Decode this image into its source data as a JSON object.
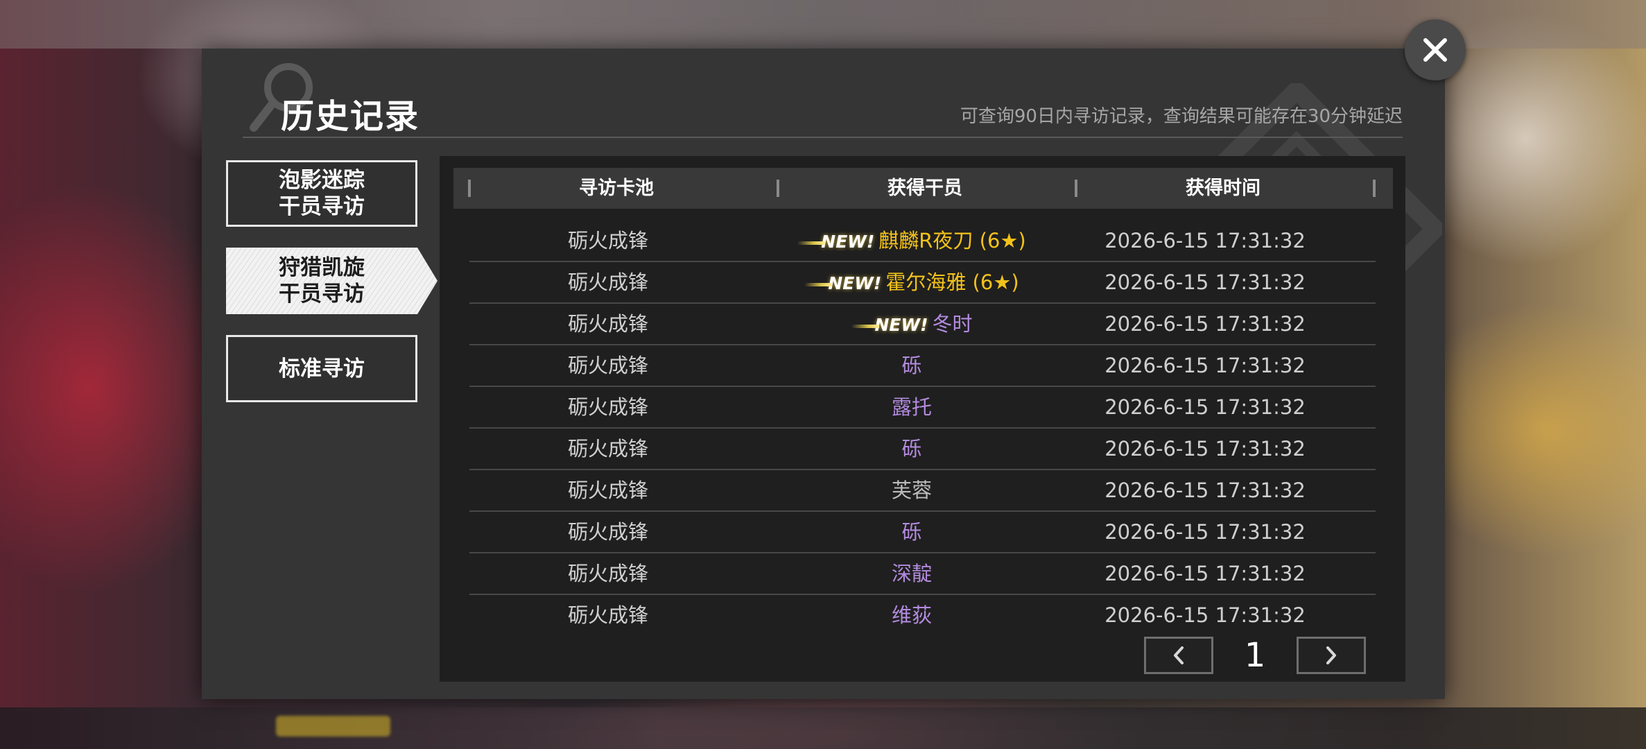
{
  "dialog": {
    "title": "历史记录",
    "subtitle": "可查询90日内寻访记录，查询结果可能存在30分钟延迟"
  },
  "tabs": [
    {
      "label": "泡影迷踪\n干员寻访",
      "active": false
    },
    {
      "label": "狩猎凯旋\n干员寻访",
      "active": true
    },
    {
      "label": "标准寻访",
      "active": false
    }
  ],
  "table": {
    "headers": [
      "寻访卡池",
      "获得干员",
      "获得时间"
    ],
    "new_label": "NEW!",
    "rows": [
      {
        "pool": "砺火成锋",
        "operator": "麒麟R夜刀 (6★)",
        "rarity": 6,
        "is_new": true,
        "time": "2026-6-15 17:31:32"
      },
      {
        "pool": "砺火成锋",
        "operator": "霍尔海雅 (6★)",
        "rarity": 6,
        "is_new": true,
        "time": "2026-6-15 17:31:32"
      },
      {
        "pool": "砺火成锋",
        "operator": "冬时",
        "rarity": 4,
        "is_new": true,
        "time": "2026-6-15 17:31:32"
      },
      {
        "pool": "砺火成锋",
        "operator": "砾",
        "rarity": 4,
        "is_new": false,
        "time": "2026-6-15 17:31:32"
      },
      {
        "pool": "砺火成锋",
        "operator": "露托",
        "rarity": 4,
        "is_new": false,
        "time": "2026-6-15 17:31:32"
      },
      {
        "pool": "砺火成锋",
        "operator": "砾",
        "rarity": 4,
        "is_new": false,
        "time": "2026-6-15 17:31:32"
      },
      {
        "pool": "砺火成锋",
        "operator": "芙蓉",
        "rarity": 3,
        "is_new": false,
        "time": "2026-6-15 17:31:32"
      },
      {
        "pool": "砺火成锋",
        "operator": "砾",
        "rarity": 4,
        "is_new": false,
        "time": "2026-6-15 17:31:32"
      },
      {
        "pool": "砺火成锋",
        "operator": "深靛",
        "rarity": 4,
        "is_new": false,
        "time": "2026-6-15 17:31:32"
      },
      {
        "pool": "砺火成锋",
        "operator": "维荻",
        "rarity": 4,
        "is_new": false,
        "time": "2026-6-15 17:31:32"
      }
    ]
  },
  "pagination": {
    "current_page": "1"
  },
  "icons": {
    "close": "close-icon",
    "prev": "chevron-left-icon",
    "next": "chevron-right-icon",
    "decor": "magnifier-icon"
  },
  "colors": {
    "six_star": "#f3c21a",
    "four_star": "#b38bdf",
    "three_star": "#bdbdbd",
    "panel_bg": "#1f1f1f",
    "dialog_bg": "#353535"
  }
}
